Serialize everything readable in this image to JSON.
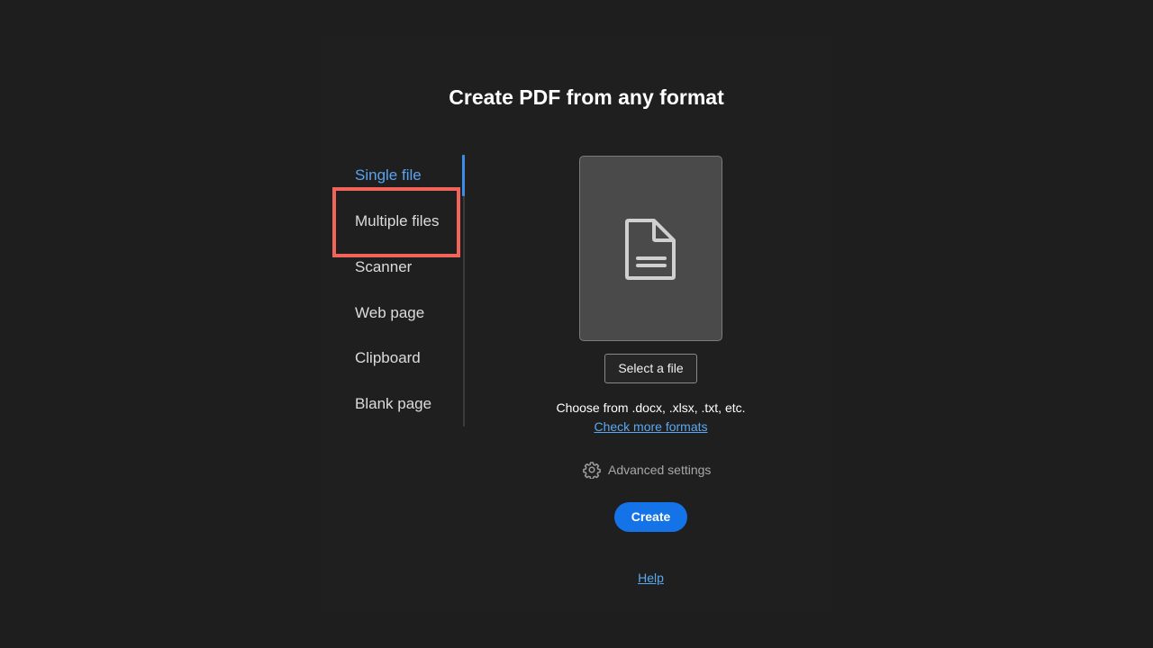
{
  "title": "Create PDF from any format",
  "nav": {
    "items": [
      {
        "label": "Single file",
        "active": true
      },
      {
        "label": "Multiple files",
        "active": false
      },
      {
        "label": "Scanner",
        "active": false
      },
      {
        "label": "Web page",
        "active": false
      },
      {
        "label": "Clipboard",
        "active": false
      },
      {
        "label": "Blank page",
        "active": false
      }
    ],
    "highlighted_item": "Multiple files"
  },
  "upload": {
    "icon": "document-icon",
    "select_button": "Select a file",
    "formats_text": "Choose from .docx, .xlsx, .txt, etc.",
    "more_formats_link": "Check more formats"
  },
  "advanced": {
    "icon": "gear-icon",
    "label": "Advanced settings"
  },
  "create_button": "Create",
  "help_link": "Help",
  "colors": {
    "background": "#1e1e1e",
    "accent": "#1473e6",
    "active_nav": "#5aa3f0",
    "highlight": "#f0645a",
    "link": "#5aa9f0"
  }
}
